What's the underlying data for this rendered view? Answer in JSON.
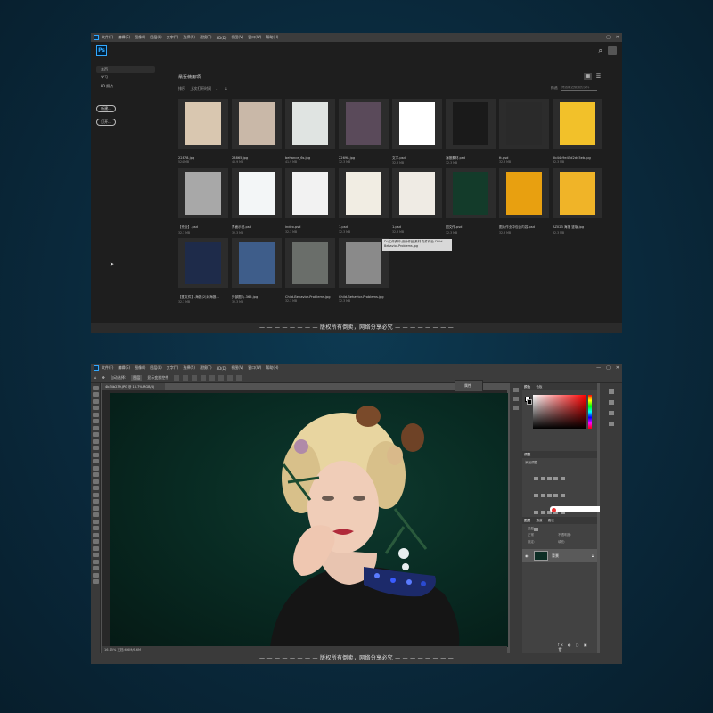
{
  "home": {
    "menu": [
      "文件(F)",
      "编辑(E)",
      "图像(I)",
      "图层(L)",
      "文字(Y)",
      "选择(S)",
      "滤镜(T)",
      "3D(D)",
      "视图(V)",
      "窗口(W)",
      "帮助(H)"
    ],
    "logo_text": "Ps",
    "nav": [
      "主页",
      "学习",
      "LR 照片"
    ],
    "buttons": [
      "新建...",
      "打开..."
    ],
    "section_title": "最近使用项",
    "sort_label": "排序",
    "sort_value": "上次打开时间",
    "filter_label": "筛选",
    "filter_placeholder": "筛选最近使用的文件",
    "files": [
      {
        "name": "22878.jpg",
        "size": "524 MB"
      },
      {
        "name": "23865.jpg",
        "size": "45.9 MB"
      },
      {
        "name": "behance_6s.jpg",
        "size": "41.9 MB"
      },
      {
        "name": "22698.jpg",
        "size": "32.3 MB"
      },
      {
        "name": "文字.psd",
        "size": "32.3 MB"
      },
      {
        "name": "海报素材.psd",
        "size": "32.3 MB"
      },
      {
        "name": "tt.psd",
        "size": "32.3 MB"
      },
      {
        "name": "5b44c9e45d2d45eb.jpg",
        "size": "32.3 MB"
      },
      {
        "name": "【作业】.psd",
        "size": "32.3 MB"
      },
      {
        "name": "界面示范.psd",
        "size": "32.3 MB"
      },
      {
        "name": "index.psd",
        "size": "32.3 MB"
      },
      {
        "name": "1.psd",
        "size": "32.3 MB"
      },
      {
        "name": "1.psd",
        "size": "32.3 MB"
      },
      {
        "name": "图文作.psd",
        "size": "32.3 MB"
      },
      {
        "name": "图片作业中包含内容.psd",
        "size": "32.3 MB"
      },
      {
        "name": "AZ023 海报 竖版.jpg",
        "size": "32.3 MB"
      },
      {
        "name": "【图文件】-海报(2)对海报...",
        "size": "32.3 MB"
      },
      {
        "name": "外部图片-365.jpg",
        "size": "32.3 MB"
      },
      {
        "name": "Child-Behavior-Problems.jpg",
        "size": "32.3 MB"
      },
      {
        "name": "Child-Behavior-Problems.jpg",
        "size": "32.3 MB"
      }
    ],
    "tooltip": "D:\\工作资料\\设计作品\\素材 文件作业 Child-Behavior-Problems.jpg",
    "watermark": "— — — — — — — — 版权所有倒卖，网络分享必究 — — — — — — — —",
    "thumb_colors": [
      "#d9c7b0",
      "#c9b8a8",
      "#e0e4e2",
      "#5a4a5a",
      "#ffffff",
      "#1a1a1a",
      "#2a2a2a",
      "#f2c12a",
      "#a8a8a8",
      "#f3f6f7",
      "#f2f2f2",
      "#f1ede3",
      "#efebe4",
      "#133b2a",
      "#e8a010",
      "#f0b428",
      "#1e2b4a",
      "#3e5d8a",
      "#6a6e6a",
      "#8a8a8a"
    ]
  },
  "editor": {
    "menu": [
      "文件(F)",
      "编辑(E)",
      "图像(I)",
      "图层(L)",
      "文字(Y)",
      "选择(S)",
      "滤镜(T)",
      "3D(D)",
      "视图(V)",
      "窗口(W)",
      "帮助(H)"
    ],
    "options": [
      "自动选择:",
      "图层",
      "显示变换控件"
    ],
    "doc_tab": "4b34b239.JPG @ 16.7%(RGB/8)",
    "float_label": "属性",
    "status": "16.15%   文档:6.6M/6.6M",
    "color_tabs": [
      "颜色",
      "色板"
    ],
    "adjust_tabs": [
      "调整"
    ],
    "adjust_label": "添加调整",
    "layer_tabs": [
      "图层",
      "通道",
      "路径"
    ],
    "layer_kind": "类型",
    "blend_mode": "正常",
    "opacity_label": "不透明度:",
    "lock_label": "锁定:",
    "fill_label": "填充:",
    "layer_name": "背景",
    "layer_footer": "fx ◐ ▢ ▣ 🗑",
    "watermark": "— — — — — — — — 版权所有倒卖，网络分享必究 — — — — — — — —"
  }
}
